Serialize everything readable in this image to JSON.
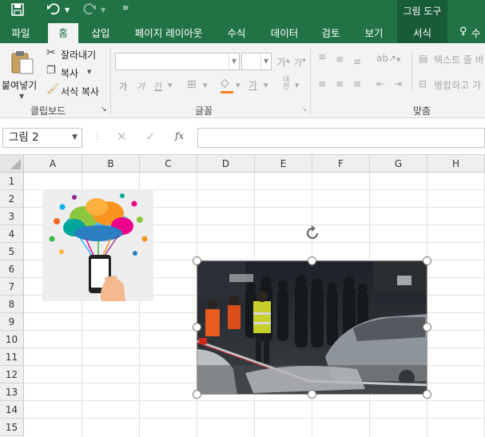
{
  "window": {
    "contextual_group": "그림 도구"
  },
  "tabs": [
    {
      "label": "파일"
    },
    {
      "label": "홈"
    },
    {
      "label": "삽입"
    },
    {
      "label": "페이지 레이아웃"
    },
    {
      "label": "수식"
    },
    {
      "label": "데이터"
    },
    {
      "label": "검토"
    },
    {
      "label": "보기"
    },
    {
      "label": "서식"
    },
    {
      "label": "수"
    }
  ],
  "ribbon": {
    "clipboard": {
      "paste_label": "붙여넣기",
      "cut_label": "잘라내기",
      "copy_label": "복사",
      "format_painter_label": "서식 복사",
      "group_label": "클립보드"
    },
    "font": {
      "font_name": "",
      "font_size": "",
      "group_label": "글꼴"
    },
    "alignment": {
      "wrap_text_label": "텍스트 줄 바",
      "merge_label": "병합하고 가",
      "group_label": "맞춤"
    }
  },
  "formula_bar": {
    "name_box": "그림 2",
    "fx_label": "fx",
    "formula_value": ""
  },
  "sheet": {
    "columns": [
      "A",
      "B",
      "C",
      "D",
      "E",
      "F",
      "G",
      "H"
    ],
    "rows": [
      "1",
      "2",
      "3",
      "4",
      "5",
      "6",
      "7",
      "8",
      "9",
      "10",
      "11",
      "12",
      "13",
      "14",
      "15"
    ]
  },
  "pictures": [
    {
      "name": "그림 1",
      "description": "smartphone-cloud-apps-illustration"
    },
    {
      "name": "그림 2",
      "description": "night-street-emergency-scene-photo",
      "selected": true
    }
  ],
  "colors": {
    "excel_green": "#217346",
    "dark_green": "#185c37",
    "ribbon_bg": "#f3f3f3"
  }
}
